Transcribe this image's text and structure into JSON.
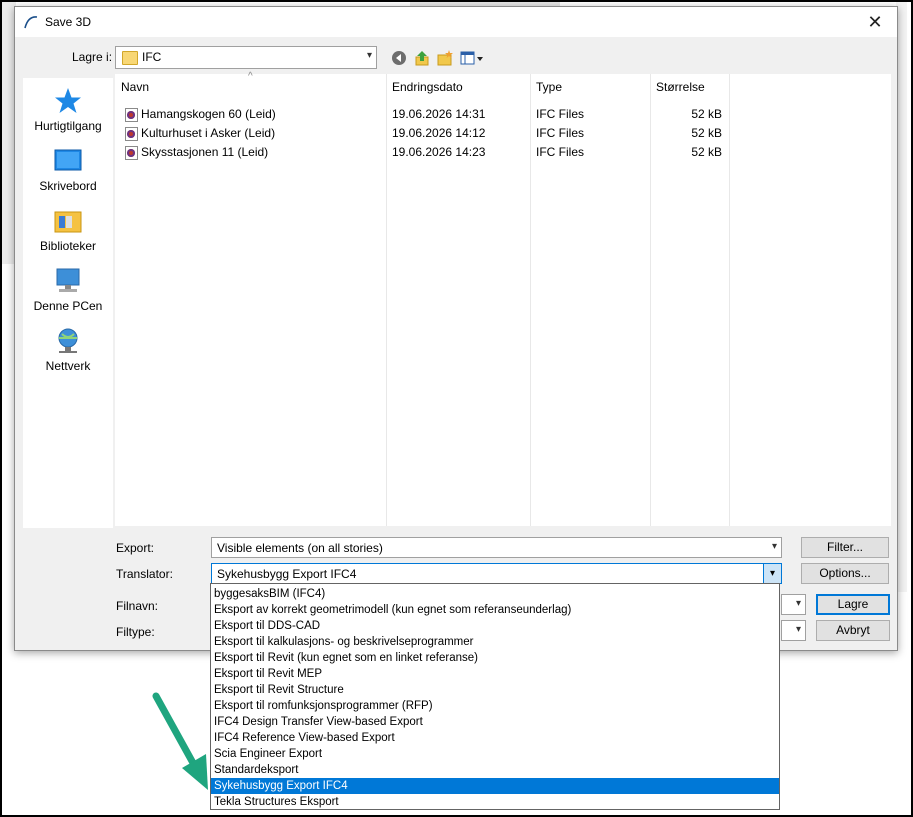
{
  "window": {
    "title": "Save 3D",
    "close_glyph": "✕"
  },
  "location": {
    "label": "Lagre i:",
    "value": "IFC"
  },
  "places": [
    {
      "label": "Hurtigtilgang",
      "icon": "star-icon"
    },
    {
      "label": "Skrivebord",
      "icon": "desktop-icon"
    },
    {
      "label": "Biblioteker",
      "icon": "libraries-icon"
    },
    {
      "label": "Denne PCen",
      "icon": "computer-icon"
    },
    {
      "label": "Nettverk",
      "icon": "network-icon"
    }
  ],
  "columns": {
    "name": "Navn",
    "date": "Endringsdato",
    "type": "Type",
    "size": "Størrelse"
  },
  "files": [
    {
      "name": "Hamangskogen 60 (Leid)",
      "date": "19.06.2026 14:31",
      "type": "IFC Files",
      "size": "52 kB"
    },
    {
      "name": "Kulturhuset i Asker (Leid)",
      "date": "19.06.2026 14:12",
      "type": "IFC Files",
      "size": "52 kB"
    },
    {
      "name": "Skysstasjonen 11 (Leid)",
      "date": "19.06.2026 14:23",
      "type": "IFC Files",
      "size": "52 kB"
    }
  ],
  "form": {
    "export_label": "Export:",
    "export_value": "Visible elements (on all stories)",
    "translator_label": "Translator:",
    "translator_value": "Sykehusbygg Export IFC4",
    "filename_label": "Filnavn:",
    "filetype_label": "Filtype:"
  },
  "buttons": {
    "filter": "Filter...",
    "options": "Options...",
    "save": "Lagre",
    "cancel": "Avbryt"
  },
  "translator_options": [
    "byggesaksBIM (IFC4)",
    "Eksport av korrekt geometrimodell (kun egnet som referanseunderlag)",
    "Eksport til DDS-CAD",
    "Eksport til kalkulasjons- og beskrivelseprogrammer",
    "Eksport til Revit (kun egnet som en linket referanse)",
    "Eksport til Revit MEP",
    "Eksport til Revit Structure",
    "Eksport til romfunksjonsprogrammer (RFP)",
    "IFC4 Design Transfer View-based Export",
    "IFC4 Reference View-based Export",
    "Scia Engineer Export",
    "Standardeksport",
    "Sykehusbygg Export IFC4",
    "Tekla Structures Eksport"
  ],
  "selected_option_index": 12,
  "colors": {
    "accent": "#0078d7",
    "annotation_arrow": "#1fa57f"
  }
}
